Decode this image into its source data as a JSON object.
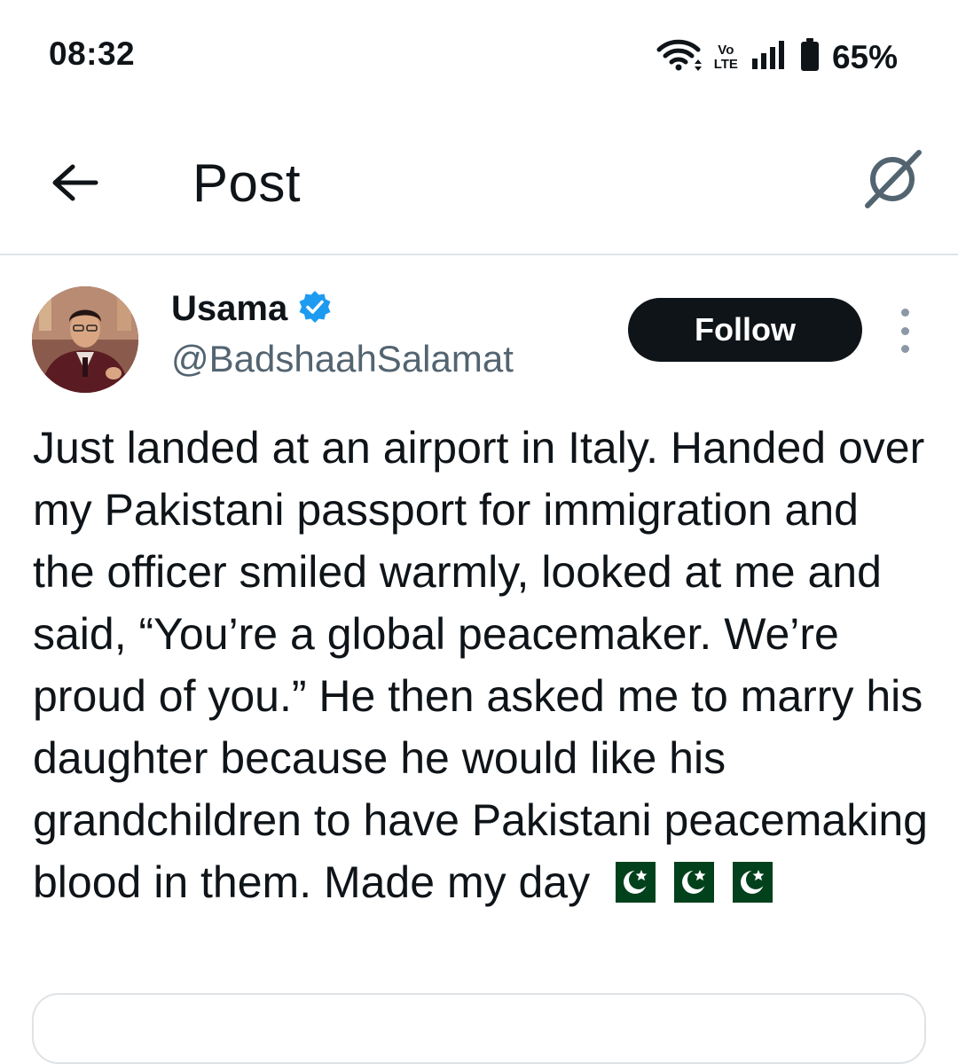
{
  "status_bar": {
    "time": "08:32",
    "network_top": "Vo",
    "network_bottom": "LTE",
    "battery": "65%",
    "icons": [
      "wifi-icon",
      "volte-icon",
      "signal-icon",
      "battery-icon"
    ]
  },
  "header": {
    "title": "Post",
    "back_icon": "arrow-left-icon",
    "grok_icon": "grok-icon"
  },
  "post": {
    "author": {
      "display_name": "Usama",
      "handle": "@BadshaahSalamat",
      "verified": true,
      "verified_color": "#1d9bf0"
    },
    "follow_label": "Follow",
    "more_icon": "more-vertical-icon",
    "text": "Just landed at an airport in Italy. Handed over my Pakistani passport for immigration and the officer smiled warmly, looked at me and said, “You’re a global peacemaker. We’re proud of you.” He then asked me to marry his daughter because he would like his grandchildren to have Pakistani peacemaking blood in them. Made my day",
    "emojis": [
      "🇵🇰",
      "🇵🇰",
      "🇵🇰"
    ]
  },
  "colors": {
    "text": "#0f1419",
    "secondary": "#536471",
    "divider": "#dfe3e6",
    "follow_bg": "#0f1419",
    "flag_green": "#01411c"
  }
}
